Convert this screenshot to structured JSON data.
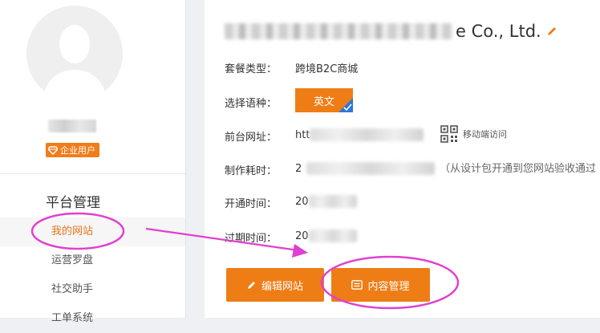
{
  "sidebar": {
    "badge_label": "企业用户",
    "section_title": "平台管理",
    "items": [
      {
        "label": "我的网站",
        "active": true
      },
      {
        "label": "运营罗盘",
        "active": false
      },
      {
        "label": "社交助手",
        "active": false
      },
      {
        "label": "工单系统",
        "active": false
      }
    ]
  },
  "site": {
    "company_suffix": "e Co., Ltd.",
    "fields": [
      {
        "label": "套餐类型：",
        "value": "跨境B2C商城"
      },
      {
        "label": "选择语种：",
        "value": "英文"
      },
      {
        "label": "前台网址：",
        "value": "htt"
      },
      {
        "label": "制作耗时：",
        "value": "2"
      },
      {
        "label": "开通时间：",
        "value": "20"
      },
      {
        "label": "过期时间：",
        "value": "20"
      }
    ],
    "mobile_access_label": "移动端访问",
    "build_time_note": "（从设计包开通到您网站验收通过"
  },
  "actions": {
    "edit_label": "编辑网站",
    "content_label": "内容管理"
  },
  "colors": {
    "accent": "#ee7d16",
    "annotation": "#e040d0",
    "check_blue": "#2b78d8"
  }
}
